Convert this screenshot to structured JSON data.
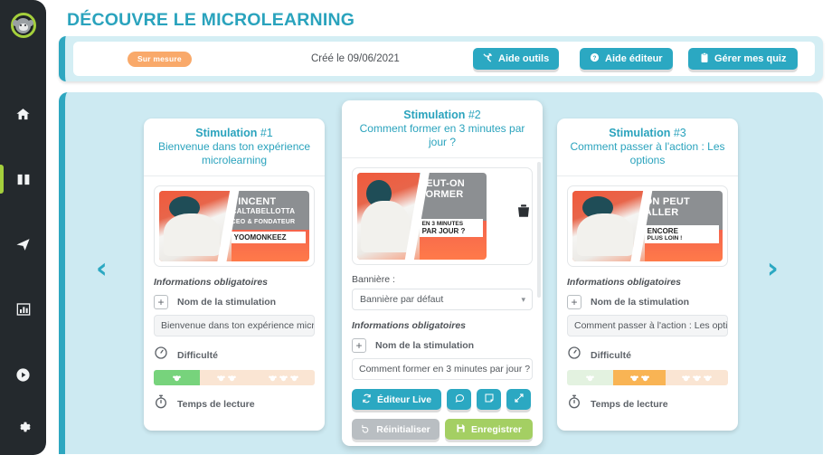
{
  "sidebar": {
    "logo_name": "yoomonkeez-logo",
    "items": [
      {
        "name": "home",
        "icon": "home-icon",
        "active": false
      },
      {
        "name": "courses",
        "icon": "book-icon",
        "active": true
      },
      {
        "name": "send",
        "icon": "paper-plane-icon",
        "active": false
      },
      {
        "name": "stats",
        "icon": "chart-bar-icon",
        "active": false
      },
      {
        "name": "media",
        "icon": "play-circle-icon",
        "active": false
      }
    ],
    "bottom_item": {
      "name": "settings",
      "icon": "gear-icon"
    }
  },
  "header": {
    "title": "DÉCOUVRE LE MICROLEARNING"
  },
  "info_bar": {
    "badge": "Sur mesure",
    "created": "Créé le 09/06/2021",
    "buttons": [
      {
        "label": "Aide outils",
        "icon": "tools-icon"
      },
      {
        "label": "Aide éditeur",
        "icon": "question-circle-icon"
      },
      {
        "label": "Gérer mes quiz",
        "icon": "clipboard-icon"
      }
    ]
  },
  "carousel": {
    "prev_icon": "chevron-left-icon",
    "next_icon": "chevron-right-icon"
  },
  "labels": {
    "required_info": "Informations obligatoires",
    "stimulation_name": "Nom de la stimulation",
    "difficulty": "Difficulté",
    "reading_time": "Temps de lecture",
    "banner": "Bannière :",
    "stimulation_word": "Stimulation "
  },
  "cards": [
    {
      "index": "#1",
      "subtitle": "Bienvenue dans ton expérience microlearning",
      "thumb": {
        "line1": "VINCENT",
        "line2": "CALTABELLOTTA",
        "line3": "CEO & FONDATEUR",
        "band": "YOOMONKEEZ",
        "band_small": ""
      },
      "name_value": "Bienvenue dans ton expérience microle",
      "difficulty_selected": 1
    },
    {
      "index": "#2",
      "subtitle": "Comment former en 3 minutes par jour ?",
      "thumb": {
        "line1": "PEUT-ON",
        "line2": "FORMER",
        "line3": "",
        "band": "PAR JOUR ?",
        "band_small": "EN 3 MINUTES"
      },
      "banner_value": "Bannière par défaut",
      "name_value": "Comment former en 3 minutes par jour ?",
      "delete_icon": "trash-icon",
      "buttons": {
        "live_editor": "Éditeur Live",
        "live_editor_icon": "refresh-icon",
        "comment_icon": "comment-icon",
        "note_icon": "note-icon",
        "expand_icon": "expand-icon",
        "reset": "Réinitialiser",
        "reset_icon": "undo-icon",
        "save": "Enregistrer",
        "save_icon": "floppy-icon"
      }
    },
    {
      "index": "#3",
      "subtitle": "Comment passer à l'action : Les options",
      "thumb": {
        "line1": "ON PEUT",
        "line2": "ALLER",
        "line3": "",
        "band": "ENCORE",
        "band_small": "PLUS LOIN !"
      },
      "name_value": "Comment passer à l'action : Les options",
      "difficulty_selected": 2
    }
  ],
  "colors": {
    "accent_teal": "#2ba8c2",
    "panel_bg": "#cdeaf2",
    "badge_orange": "#f9a96a",
    "save_green": "#a4cf63",
    "sidebar_dark": "#24292d",
    "active_green": "#a4cf3c"
  }
}
